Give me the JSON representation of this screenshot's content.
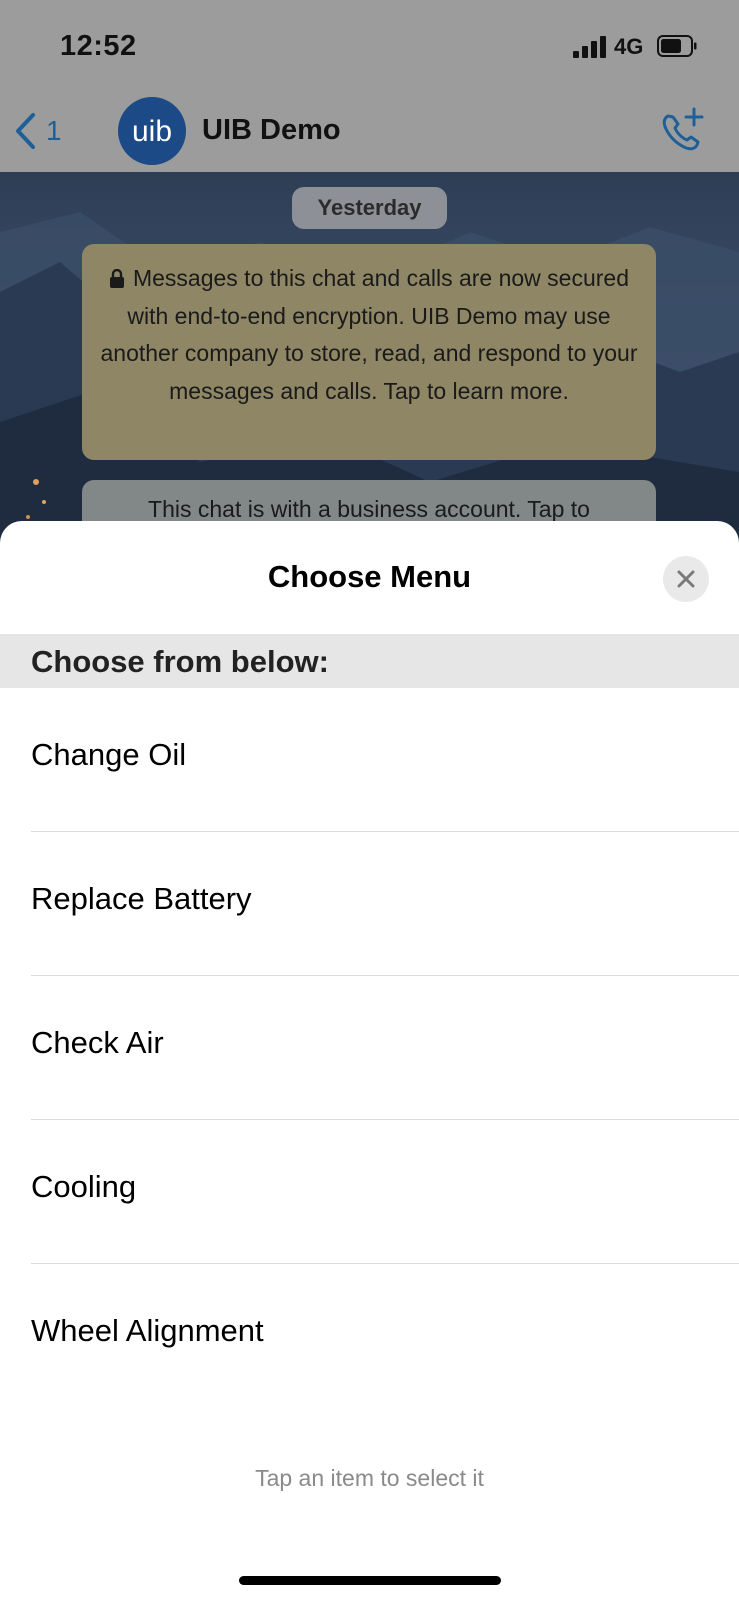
{
  "status_bar": {
    "time": "12:52",
    "network": "4G"
  },
  "header": {
    "back_count": "1",
    "contact_name": "UIB Demo",
    "avatar_text": "uib"
  },
  "chat": {
    "date_label": "Yesterday",
    "encryption_notice": "Messages to this chat and calls are now secured with end-to-end encryption. UIB Demo may use another company to store, read, and respond to your messages and calls. Tap to learn more.",
    "business_notice": "This chat is with a business account. Tap to"
  },
  "sheet": {
    "title": "Choose Menu",
    "section_label": "Choose from below:",
    "options": [
      {
        "label": "Change Oil"
      },
      {
        "label": "Replace Battery"
      },
      {
        "label": "Check Air"
      },
      {
        "label": "Cooling"
      },
      {
        "label": "Wheel Alignment"
      }
    ],
    "hint": "Tap an item to select it"
  },
  "colors": {
    "accent": "#1f5f98",
    "sheet_background": "#ffffff",
    "section_header_background": "#e6e6e6",
    "notice_bubble": "#8e8665"
  },
  "icons": [
    "signal-icon",
    "battery-icon",
    "back-chevron-icon",
    "phone-add-icon",
    "lock-icon",
    "close-icon"
  ]
}
